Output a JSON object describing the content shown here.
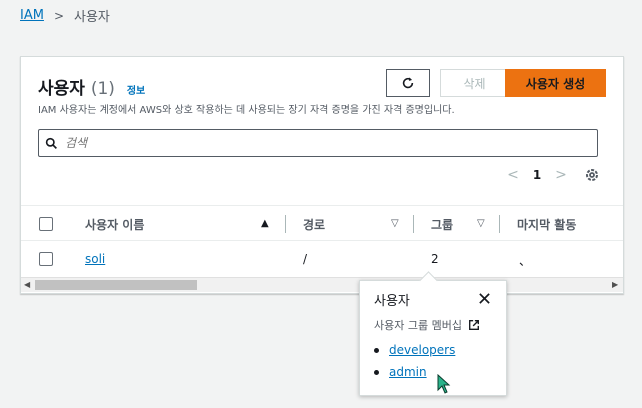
{
  "breadcrumb": {
    "root": "IAM",
    "current": "사용자"
  },
  "header": {
    "title": "사용자",
    "count": "(1)",
    "info": "정보",
    "description": "IAM 사용자는 계정에서 AWS와 상호 작용하는 데 사용되는 장기 자격 증명을 가진 자격 증명입니다."
  },
  "actions": {
    "delete": "삭제",
    "create": "사용자 생성"
  },
  "search": {
    "placeholder": "검색"
  },
  "pagination": {
    "page": "1"
  },
  "table": {
    "columns": [
      "사용자 이름",
      "경로",
      "그룹",
      "마지막 활동"
    ],
    "rows": [
      {
        "name": "soli",
        "path": "/",
        "groups": "2",
        "last_activity": "、"
      }
    ]
  },
  "popover": {
    "title": "사용자",
    "subtitle": "사용자 그룹 멤버십",
    "items": [
      "developers",
      "admin"
    ]
  },
  "colors": {
    "primary": "#ec7211",
    "link": "#0073bb"
  }
}
